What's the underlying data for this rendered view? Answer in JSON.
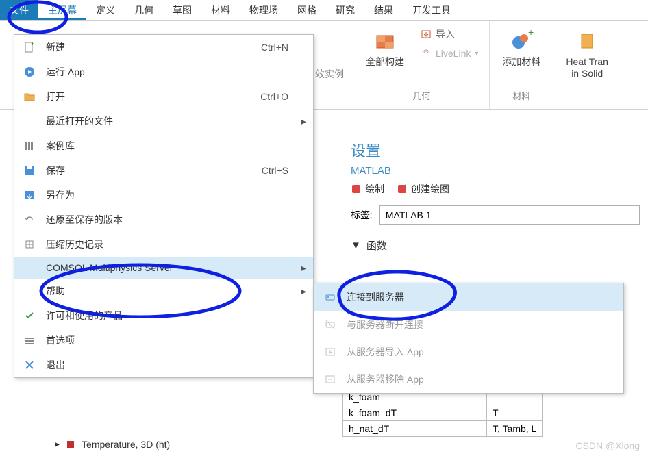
{
  "tabs": {
    "file": "文件",
    "home": "主屏幕",
    "define": "定义",
    "geometry": "几何",
    "sketch": "草图",
    "material": "材料",
    "physics": "物理场",
    "mesh": "网格",
    "study": "研究",
    "results": "结果",
    "devtools": "开发工具"
  },
  "ribbon": {
    "build_all": "全部构建",
    "import": "导入",
    "livelink": "LiveLink",
    "group_geom": "几何",
    "add_material": "添加材料",
    "group_material": "材料",
    "heat_transfer": "Heat Tran\nin Solid",
    "examples_frag": "效实例"
  },
  "file_menu": {
    "items": [
      {
        "label": "新建",
        "shortcut": "Ctrl+N",
        "icon": "doc-plus"
      },
      {
        "label": "运行 App",
        "shortcut": "",
        "icon": "app-run"
      },
      {
        "label": "打开",
        "shortcut": "Ctrl+O",
        "icon": "folder-open"
      },
      {
        "label": "最近打开的文件",
        "shortcut": "",
        "icon": "",
        "arrow": true
      },
      {
        "label": "案例库",
        "shortcut": "",
        "icon": "library"
      },
      {
        "label": "保存",
        "shortcut": "Ctrl+S",
        "icon": "disk"
      },
      {
        "label": "另存为",
        "shortcut": "",
        "icon": "disk-arrow"
      },
      {
        "label": "还原至保存的版本",
        "shortcut": "",
        "icon": "revert"
      },
      {
        "label": "压缩历史记录",
        "shortcut": "",
        "icon": "compress"
      },
      {
        "label": "COMSOL Multiphysics Server",
        "shortcut": "",
        "icon": "",
        "arrow": true,
        "highlight": true
      },
      {
        "label": "帮助",
        "shortcut": "",
        "icon": "",
        "arrow": true
      },
      {
        "label": "许可和使用的产品",
        "shortcut": "",
        "icon": "check"
      },
      {
        "label": "首选项",
        "shortcut": "",
        "icon": "prefs"
      },
      {
        "label": "退出",
        "shortcut": "",
        "icon": "exit"
      }
    ]
  },
  "sub_menu": {
    "items": [
      {
        "label": "连接到服务器",
        "disabled": false,
        "highlight": true,
        "icon": "connect"
      },
      {
        "label": "与服务器断开连接",
        "disabled": true,
        "icon": "disconnect"
      },
      {
        "label": "从服务器导入 App",
        "disabled": true,
        "icon": "import-app"
      },
      {
        "label": "从服务器移除 App",
        "disabled": true,
        "icon": "remove-app"
      }
    ]
  },
  "settings": {
    "title": "设置",
    "subtitle": "MATLAB",
    "btn_plot": "绘制",
    "btn_create_plot": "创建绘图",
    "label_tag": "标签:",
    "tag_value": "MATLAB 1",
    "section_functions": "函数"
  },
  "fn_table": {
    "rows": [
      {
        "name": "k_foam",
        "args": ""
      },
      {
        "name": "k_foam_dT",
        "args": "T"
      },
      {
        "name": "h_nat_dT",
        "args": "T, Tamb, L"
      }
    ]
  },
  "tree": {
    "leaf": "Temperature, 3D (ht)"
  },
  "watermark": "CSDN @Xlong"
}
